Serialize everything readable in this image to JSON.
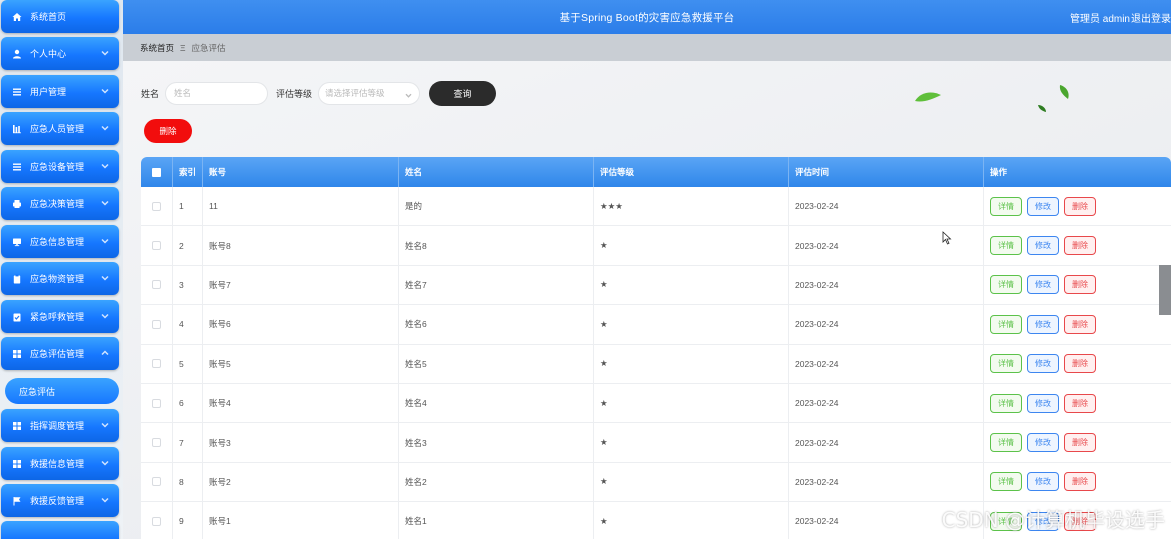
{
  "header": {
    "title": "基于Spring Boot的灾害应急救援平台",
    "user": "管理员 admin",
    "logout": "退出登录"
  },
  "sidebar": {
    "items": [
      {
        "label": "系统首页",
        "icon": "home-icon"
      },
      {
        "label": "个人中心",
        "icon": "user-icon"
      },
      {
        "label": "用户管理",
        "icon": "list-icon"
      },
      {
        "label": "应急人员管理",
        "icon": "chart-icon"
      },
      {
        "label": "应急设备管理",
        "icon": "list-icon"
      },
      {
        "label": "应急决策管理",
        "icon": "printer-icon"
      },
      {
        "label": "应急信息管理",
        "icon": "monitor-icon"
      },
      {
        "label": "应急物资管理",
        "icon": "clipboard-icon"
      },
      {
        "label": "紧急呼救管理",
        "icon": "task-icon"
      },
      {
        "label": "应急评估管理",
        "icon": "grid-icon"
      },
      {
        "label": "指挥调度管理",
        "icon": "grid-icon"
      },
      {
        "label": "救援信息管理",
        "icon": "grid-icon"
      },
      {
        "label": "救援反馈管理",
        "icon": "flag-icon"
      }
    ],
    "active_sub": "应急评估"
  },
  "breadcrumb": {
    "home": "系统首页",
    "separator": "Ξ",
    "current": "应急评估"
  },
  "search": {
    "name_label": "姓名",
    "name_placeholder": "姓名",
    "level_label": "评估等级",
    "level_placeholder": "请选择评估等级",
    "query_button": "查询"
  },
  "actions": {
    "delete_button": "删除"
  },
  "table": {
    "headers": [
      "索引",
      "账号",
      "姓名",
      "评估等级",
      "评估时间",
      "操作"
    ],
    "rows": [
      {
        "idx": "1",
        "account": "11",
        "name": "是的",
        "level": "★★★",
        "time": "2023-02-24"
      },
      {
        "idx": "2",
        "account": "账号8",
        "name": "姓名8",
        "level": "★",
        "time": "2023-02-24"
      },
      {
        "idx": "3",
        "account": "账号7",
        "name": "姓名7",
        "level": "★",
        "time": "2023-02-24"
      },
      {
        "idx": "4",
        "account": "账号6",
        "name": "姓名6",
        "level": "★",
        "time": "2023-02-24"
      },
      {
        "idx": "5",
        "account": "账号5",
        "name": "姓名5",
        "level": "★",
        "time": "2023-02-24"
      },
      {
        "idx": "6",
        "account": "账号4",
        "name": "姓名4",
        "level": "★",
        "time": "2023-02-24"
      },
      {
        "idx": "7",
        "account": "账号3",
        "name": "姓名3",
        "level": "★",
        "time": "2023-02-24"
      },
      {
        "idx": "8",
        "account": "账号2",
        "name": "姓名2",
        "level": "★",
        "time": "2023-02-24"
      },
      {
        "idx": "9",
        "account": "账号1",
        "name": "姓名1",
        "level": "★",
        "time": "2023-02-24"
      }
    ],
    "op_labels": {
      "detail": "详情",
      "edit": "修改",
      "delete": "删除"
    }
  },
  "watermark": "CSDN @计算机毕设选手",
  "colors": {
    "header": "#2b7de9",
    "nav": "#1677ff",
    "delete": "#f20d0d",
    "query": "#2b2b2b",
    "op_detail": "#5cc24a",
    "op_edit": "#3d86f0",
    "op_delete": "#e8484b"
  }
}
